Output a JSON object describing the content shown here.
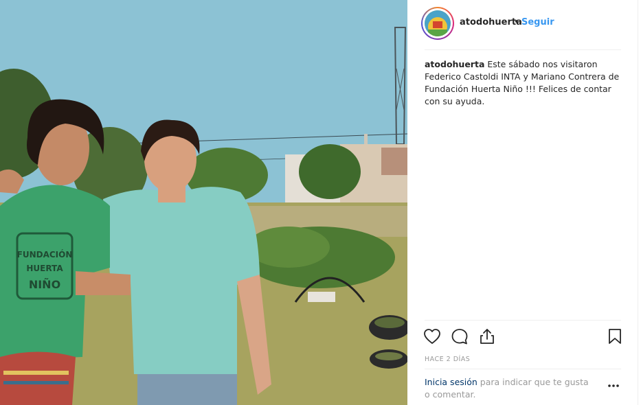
{
  "post": {
    "username": "atodohuerta",
    "separator": "•",
    "follow_label": "Seguir",
    "caption_user": "atodohuerta",
    "caption_text": "Este sábado nos visitaron Federico Castoldi INTA y Mariano Contrera de Fundación Huerta Niño !!! Felices de contar con su ayuda.",
    "time_ago": "HACE 2 DÍAS"
  },
  "photo": {
    "shirt_print": [
      "FUNDACIÓN",
      "HUERTA",
      "NIÑO"
    ]
  },
  "footer": {
    "login_link": "Inicia sesión",
    "login_text": " para indicar que te gusta o comentar."
  },
  "icons": {
    "like": "heart-icon",
    "comment": "comment-icon",
    "share": "share-icon",
    "save": "bookmark-icon",
    "more": "more-options-icon"
  },
  "colors": {
    "link_blue": "#3897f0",
    "login_blue": "#003569",
    "text": "#262626",
    "muted": "#999999",
    "border": "#efefef"
  }
}
